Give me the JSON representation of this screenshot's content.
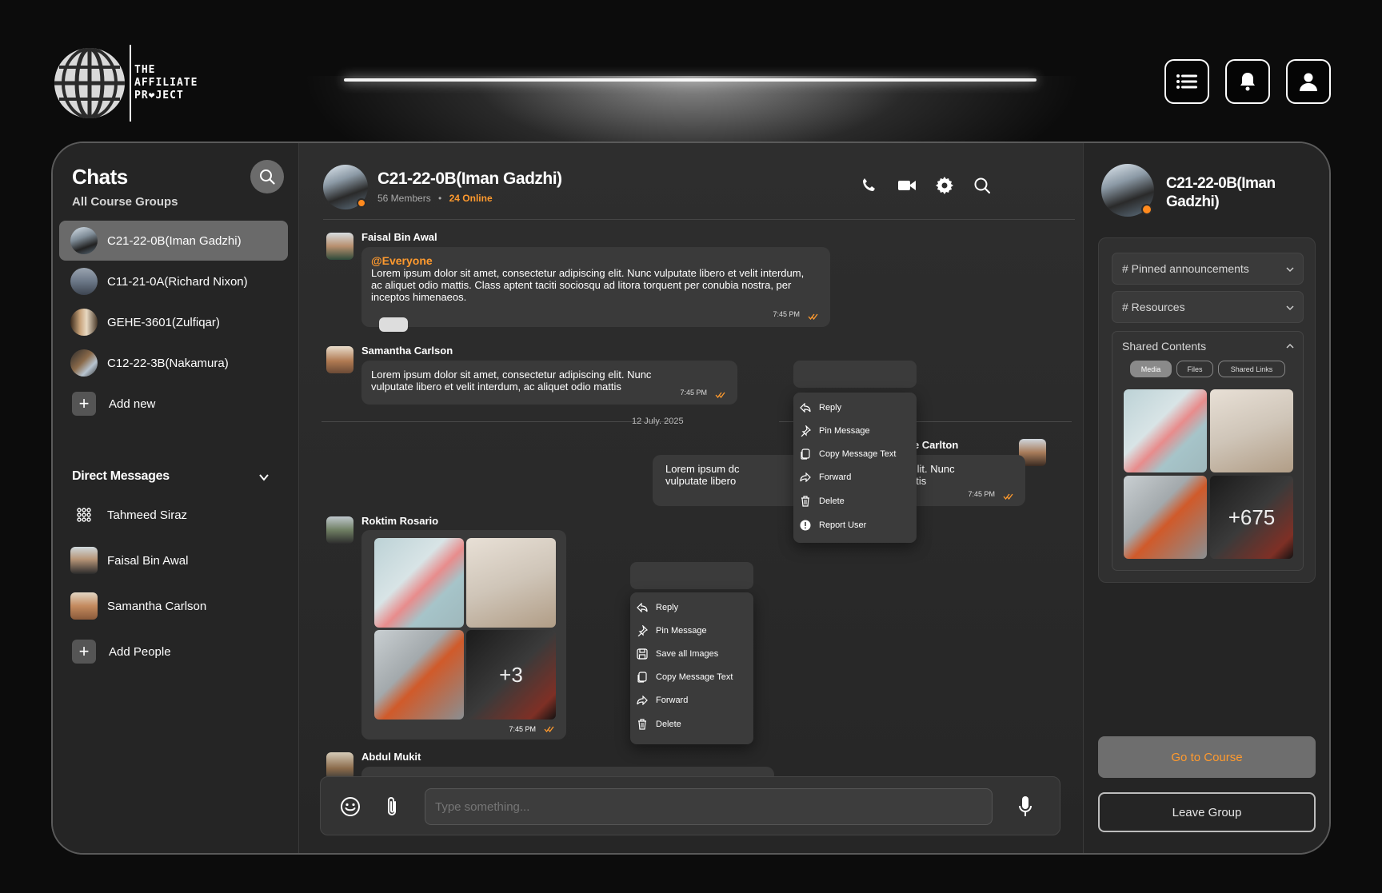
{
  "brand": {
    "line1": "THE",
    "line2": "AFFILIATE",
    "line3": "PR❤JECT"
  },
  "topbar": {
    "menu_icon": "menu-icon",
    "bell_icon": "bell-icon",
    "user_icon": "user-icon"
  },
  "sidebar": {
    "title": "Chats",
    "subtitle": "All Course Groups",
    "groups": [
      {
        "label": "C21-22-0B(Iman Gadzhi)",
        "active": true
      },
      {
        "label": "C11-21-0A(Richard Nixon)"
      },
      {
        "label": "GEHE-3601(Zulfiqar)"
      },
      {
        "label": "C12-22-3B(Nakamura)"
      }
    ],
    "add_new": "Add new",
    "dm_title": "Direct Messages",
    "dms": [
      {
        "label": "Tahmeed Siraz"
      },
      {
        "label": "Faisal Bin Awal"
      },
      {
        "label": "Samantha Carlson"
      }
    ],
    "add_people": "Add People"
  },
  "chat": {
    "title": "C21-22-0B(Iman Gadzhi)",
    "members": "56 Members",
    "online": "24 Online",
    "messages": [
      {
        "sender": "Faisal Bin Awal",
        "mention": "@Everyone",
        "text": "Lorem ipsum dolor sit amet, consectetur adipiscing elit. Nunc vulputate libero et velit interdum, ac aliquet odio mattis. Class aptent taciti sociosqu ad litora torquent per conubia nostra, per inceptos himenaeos.",
        "time": "7:45 PM"
      },
      {
        "sender": "Samantha Carlson",
        "text": "Lorem ipsum dolor sit amet, consectetur adipiscing elit. Nunc vulputate libero et velit interdum, ac aliquet odio mattis",
        "time": "7:45 PM"
      },
      {
        "sender": "Cole Carlton",
        "text_left": "Lorem ipsum dc",
        "text_left2": "vulputate libero",
        "text_right": "adipiscing elit. Nunc",
        "text_right2": "iet odio mattis",
        "time": "7:45 PM"
      },
      {
        "sender": "Roktim Rosario",
        "more": "+3",
        "time": "7:45 PM"
      },
      {
        "sender": "Abdul Mukit"
      }
    ],
    "date_separator": "12 July. 2025",
    "menu1": [
      "Reply",
      "Pin Message",
      "Copy Message Text",
      "Forward",
      "Delete",
      "Report User"
    ],
    "menu2": [
      "Reply",
      "Pin Message",
      "Save all Images",
      "Copy Message Text",
      "Forward",
      "Delete"
    ],
    "input_placeholder": "Type something..."
  },
  "right": {
    "title": "C21-22-0B(Iman Gadzhi)",
    "pinned": "# Pinned announcements",
    "resources": "# Resources",
    "shared": "Shared Contents",
    "tabs": [
      "Media",
      "Files",
      "Shared Links"
    ],
    "more_count": "+675",
    "go": "Go to Course",
    "leave": "Leave Group"
  },
  "colors": {
    "accent": "#ff9a2e",
    "bg": "#0c0c0c",
    "panel": "#252525"
  }
}
